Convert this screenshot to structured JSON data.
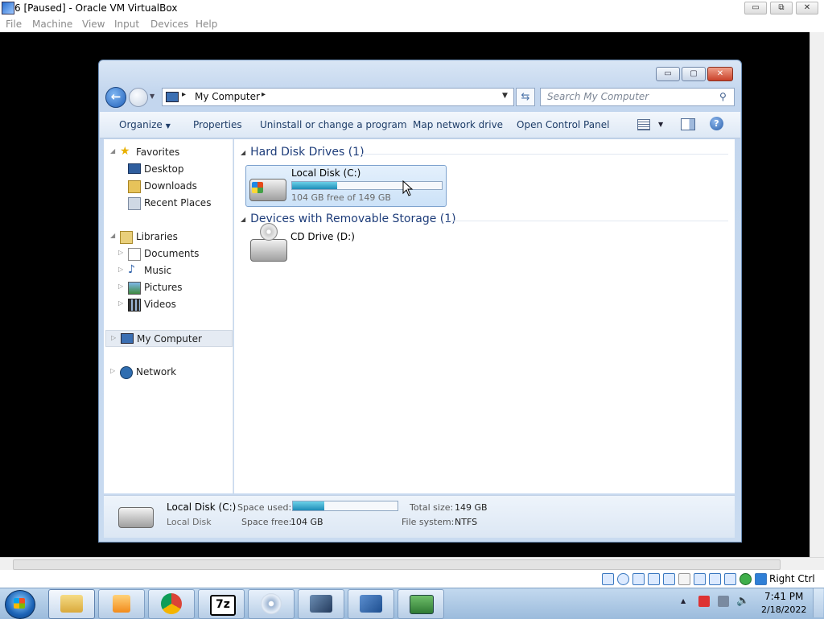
{
  "host": {
    "title": "6 [Paused] - Oracle VM VirtualBox",
    "menu": [
      "File",
      "Machine",
      "View",
      "Input",
      "Devices",
      "Help"
    ],
    "controls": {
      "minimize": "▭",
      "restore": "⧉",
      "close": "✕"
    },
    "host_key": "Right Ctrl"
  },
  "explorer": {
    "controls": {
      "minimize": "▭",
      "maximize": "▢",
      "close": "✕"
    },
    "nav_back": "←",
    "address": {
      "location": "My Computer",
      "separator": "▸"
    },
    "search": {
      "placeholder": "Search My Computer"
    },
    "toolbar": {
      "organize": "Organize",
      "properties": "Properties",
      "uninstall": "Uninstall or change a program",
      "map_drive": "Map network drive",
      "control_panel": "Open Control Panel",
      "help": "?"
    },
    "sidebar": {
      "favorites": {
        "label": "Favorites",
        "items": [
          "Desktop",
          "Downloads",
          "Recent Places"
        ]
      },
      "libraries": {
        "label": "Libraries",
        "items": [
          "Documents",
          "Music",
          "Pictures",
          "Videos"
        ]
      },
      "my_computer": "My Computer",
      "network": "Network"
    },
    "groups": {
      "hdd": {
        "header": "Hard Disk Drives (1)",
        "drive": {
          "name": "Local Disk (C:)",
          "free_text": "104 GB free of 149 GB",
          "used_fraction": 0.3
        }
      },
      "removable": {
        "header": "Devices with Removable Storage (1)",
        "drive": {
          "name": "CD Drive (D:)"
        }
      }
    },
    "details": {
      "name": "Local Disk (C:)",
      "type": "Local Disk",
      "space_used_label": "Space used:",
      "space_free_label": "Space free:",
      "space_free_value": "104 GB",
      "total_size_label": "Total size:",
      "total_size_value": "149 GB",
      "file_system_label": "File system:",
      "file_system_value": "NTFS",
      "used_fraction": 0.3
    }
  },
  "taskbar": {
    "clock_time": "7:41 PM",
    "clock_date": "2/18/2022"
  },
  "colors": {
    "accent_blue": "#1e3d7a",
    "disk_bar": "#1e8cb8",
    "selection": "#cce2f8"
  }
}
